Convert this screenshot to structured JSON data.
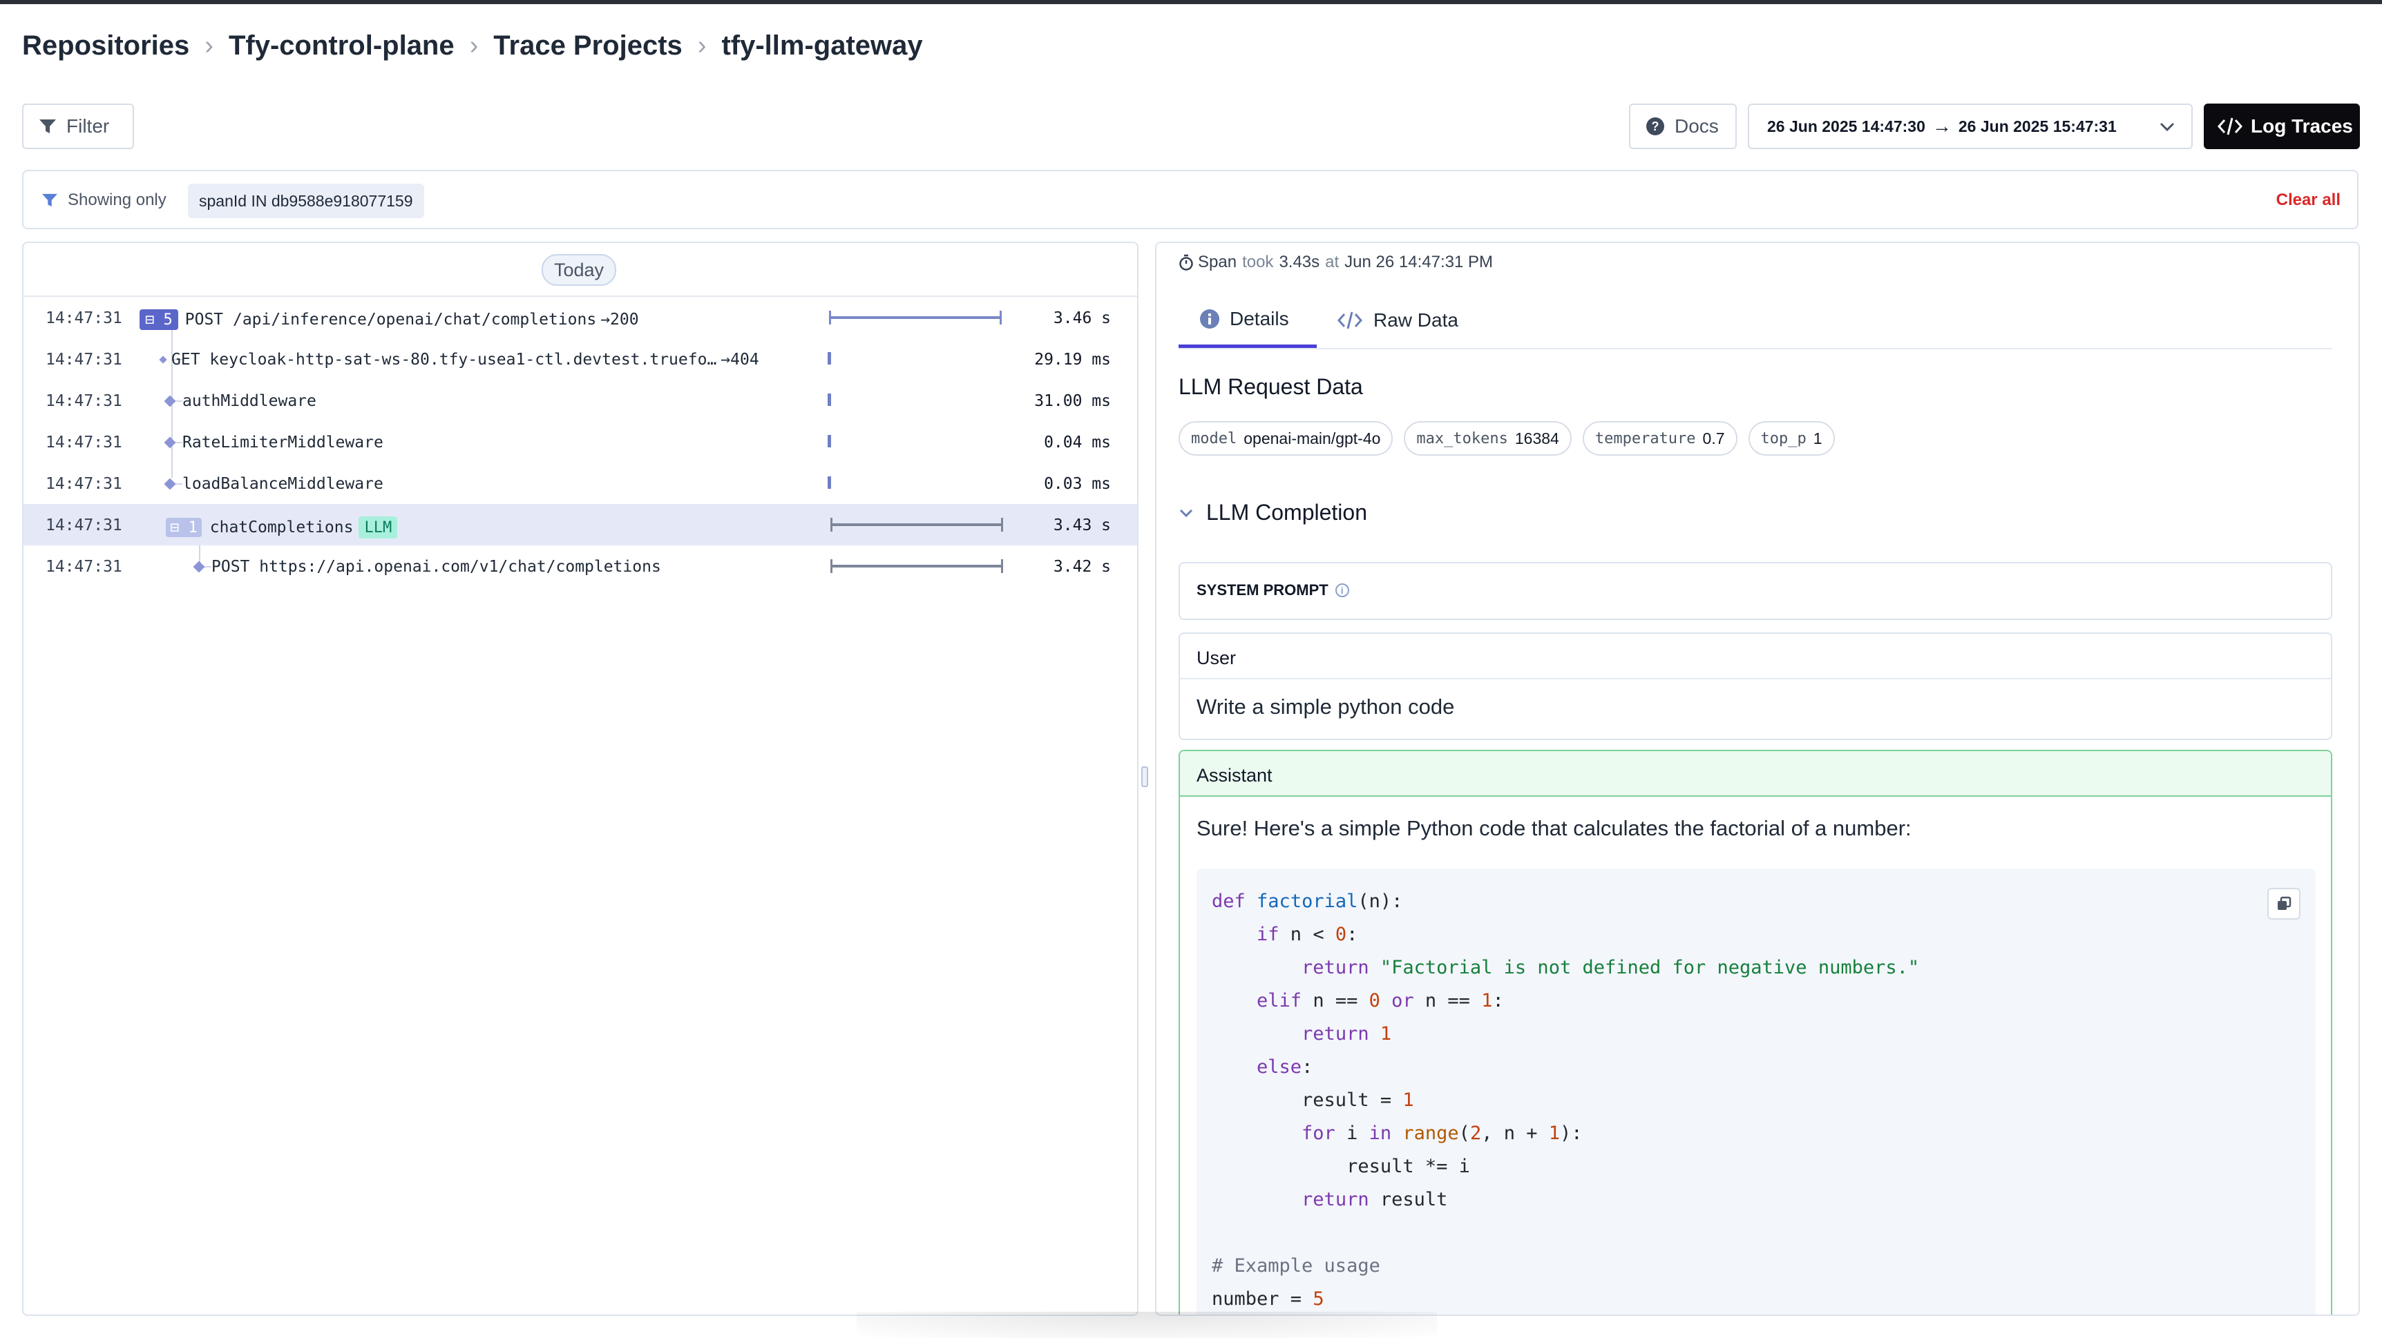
{
  "breadcrumb": [
    "Repositories",
    "Tfy-control-plane",
    "Trace Projects",
    "tfy-llm-gateway"
  ],
  "toolbar": {
    "filter_label": "Filter",
    "docs_label": "Docs",
    "date_from": "26 Jun 2025 14:47:30",
    "date_to": "26 Jun 2025 15:47:31",
    "log_traces_label": "Log Traces"
  },
  "filter_row": {
    "showing_label": "Showing only",
    "chip": "spanId IN db9588e918077159",
    "clear_all": "Clear all"
  },
  "trace_list": {
    "date_group": "Today",
    "rows": [
      {
        "time": "14:47:31",
        "badge": "5",
        "name": "POST /api/inference/openai/chat/completions",
        "status": "200",
        "duration": "3.46 s",
        "bar_start": 0.0,
        "bar_end": 1.0
      },
      {
        "time": "14:47:31",
        "name": "GET keycloak-http-sat-ws-80.tfy-usea1-ctl.devtest.truefo…",
        "status": "404",
        "duration": "29.19 ms"
      },
      {
        "time": "14:47:31",
        "name": "authMiddleware",
        "duration": "31.00 ms"
      },
      {
        "time": "14:47:31",
        "name": "RateLimiterMiddleware",
        "duration": "0.04 ms"
      },
      {
        "time": "14:47:31",
        "name": "loadBalanceMiddleware",
        "duration": "0.03 ms"
      },
      {
        "time": "14:47:31",
        "badge": "1",
        "name": "chatCompletions",
        "tag": "LLM",
        "duration": "3.43 s",
        "bar_start": 0.01,
        "bar_end": 1.0
      },
      {
        "time": "14:47:31",
        "name": "POST https://api.openai.com/v1/chat/completions",
        "duration": "3.42 s",
        "bar_start": 0.01,
        "bar_end": 1.0
      }
    ]
  },
  "span": {
    "prefix": "Span",
    "took_word": "took",
    "duration": "3.43s",
    "at_word": "at",
    "timestamp": "Jun 26 14:47:31 PM"
  },
  "tabs": {
    "details": "Details",
    "raw": "Raw Data"
  },
  "request": {
    "title": "LLM Request Data",
    "params": [
      {
        "key": "model",
        "value": "openai-main/gpt-4o"
      },
      {
        "key": "max_tokens",
        "value": "16384"
      },
      {
        "key": "temperature",
        "value": "0.7"
      },
      {
        "key": "top_p",
        "value": "1"
      }
    ]
  },
  "completion": {
    "title": "LLM Completion",
    "system_label": "SYSTEM PROMPT",
    "user_label": "User",
    "user_message": "Write a simple python code",
    "assistant_label": "Assistant",
    "assistant_intro": "Sure! Here's a simple Python code that calculates the factorial of a number:",
    "code": "def factorial(n):\n    if n < 0:\n        return \"Factorial is not defined for negative numbers.\"\n    elif n == 0 or n == 1:\n        return 1\n    else:\n        result = 1\n        for i in range(2, n + 1):\n            result *= i\n        return result\n\n# Example usage\nnumber = 5"
  },
  "colors": {
    "accent": "#4b3fd8",
    "llm_tag": "#a8f0dc",
    "assistant_border": "#7ed29a",
    "clear_all": "#dc2626"
  }
}
